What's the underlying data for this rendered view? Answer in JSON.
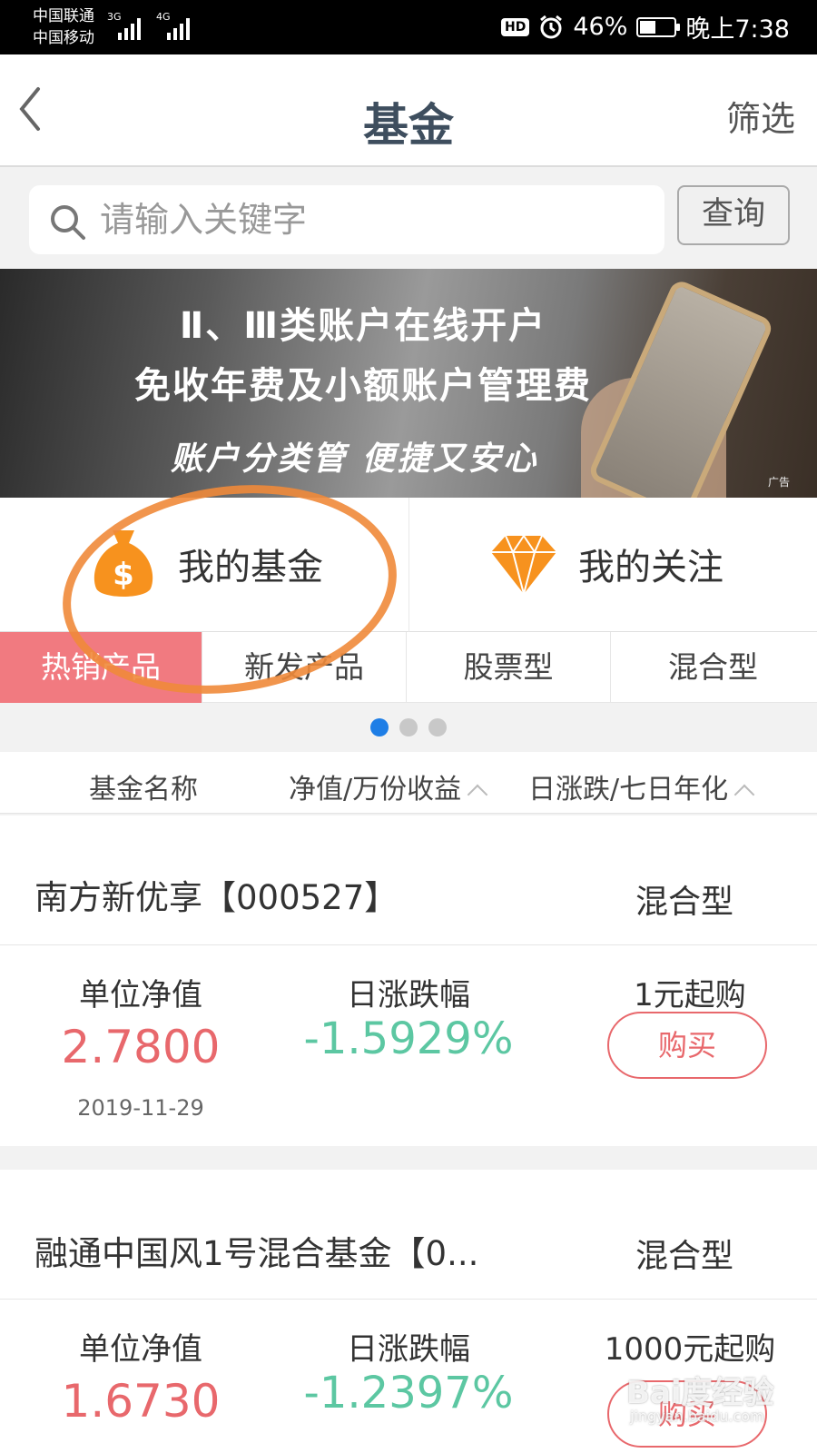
{
  "status_bar": {
    "carrier1": "中国联通",
    "carrier2": "中国移动",
    "net1": "3G",
    "net2": "4G",
    "hd_badge": "HD",
    "battery": "46%",
    "battery_level": 0.46,
    "time": "晚上7:38"
  },
  "header": {
    "title": "基金",
    "filter_label": "筛选"
  },
  "search": {
    "placeholder": "请输入关键字",
    "button_label": "查询"
  },
  "banner": {
    "line1": "Ⅱ、Ⅲ类账户在线开户",
    "line2": "免收年费及小额账户管理费",
    "line3": "账户分类管  便捷又安心",
    "ad_tag": "广告"
  },
  "quick_entries": [
    {
      "label": "我的基金",
      "icon": "money-bag-icon"
    },
    {
      "label": "我的关注",
      "icon": "diamond-icon"
    }
  ],
  "tabs": [
    {
      "label": "热销产品",
      "active": true
    },
    {
      "label": "新发产品",
      "active": false
    },
    {
      "label": "股票型",
      "active": false
    },
    {
      "label": "混合型",
      "active": false
    }
  ],
  "carousel": {
    "count": 3,
    "active_index": 0
  },
  "columns": {
    "name": "基金名称",
    "nav": "净值/万份收益",
    "change": "日涨跌/七日年化"
  },
  "funds": [
    {
      "name": "南方新优享【000527】",
      "type": "混合型",
      "nav_label": "单位净值",
      "nav": "2.7800",
      "date": "2019-11-29",
      "change_label": "日涨跌幅",
      "change": "-1.5929%",
      "min_buy": "1元起购",
      "buy_label": "购买"
    },
    {
      "name": "融通中国风1号混合基金【0...",
      "type": "混合型",
      "nav_label": "单位净值",
      "nav": "1.6730",
      "change_label": "日涨跌幅",
      "change": "-1.2397%",
      "min_buy": "1000元起购",
      "buy_label": "购买"
    }
  ],
  "colors": {
    "accent_red": "#e8686c",
    "tab_active": "#f17a80",
    "positive_green": "#5cc7a2",
    "dot_active": "#1e7ee6",
    "annotation_orange": "#ef8a3a"
  },
  "watermark": {
    "main": "Bai度经验",
    "sub": "jingyan.baidu.com"
  }
}
